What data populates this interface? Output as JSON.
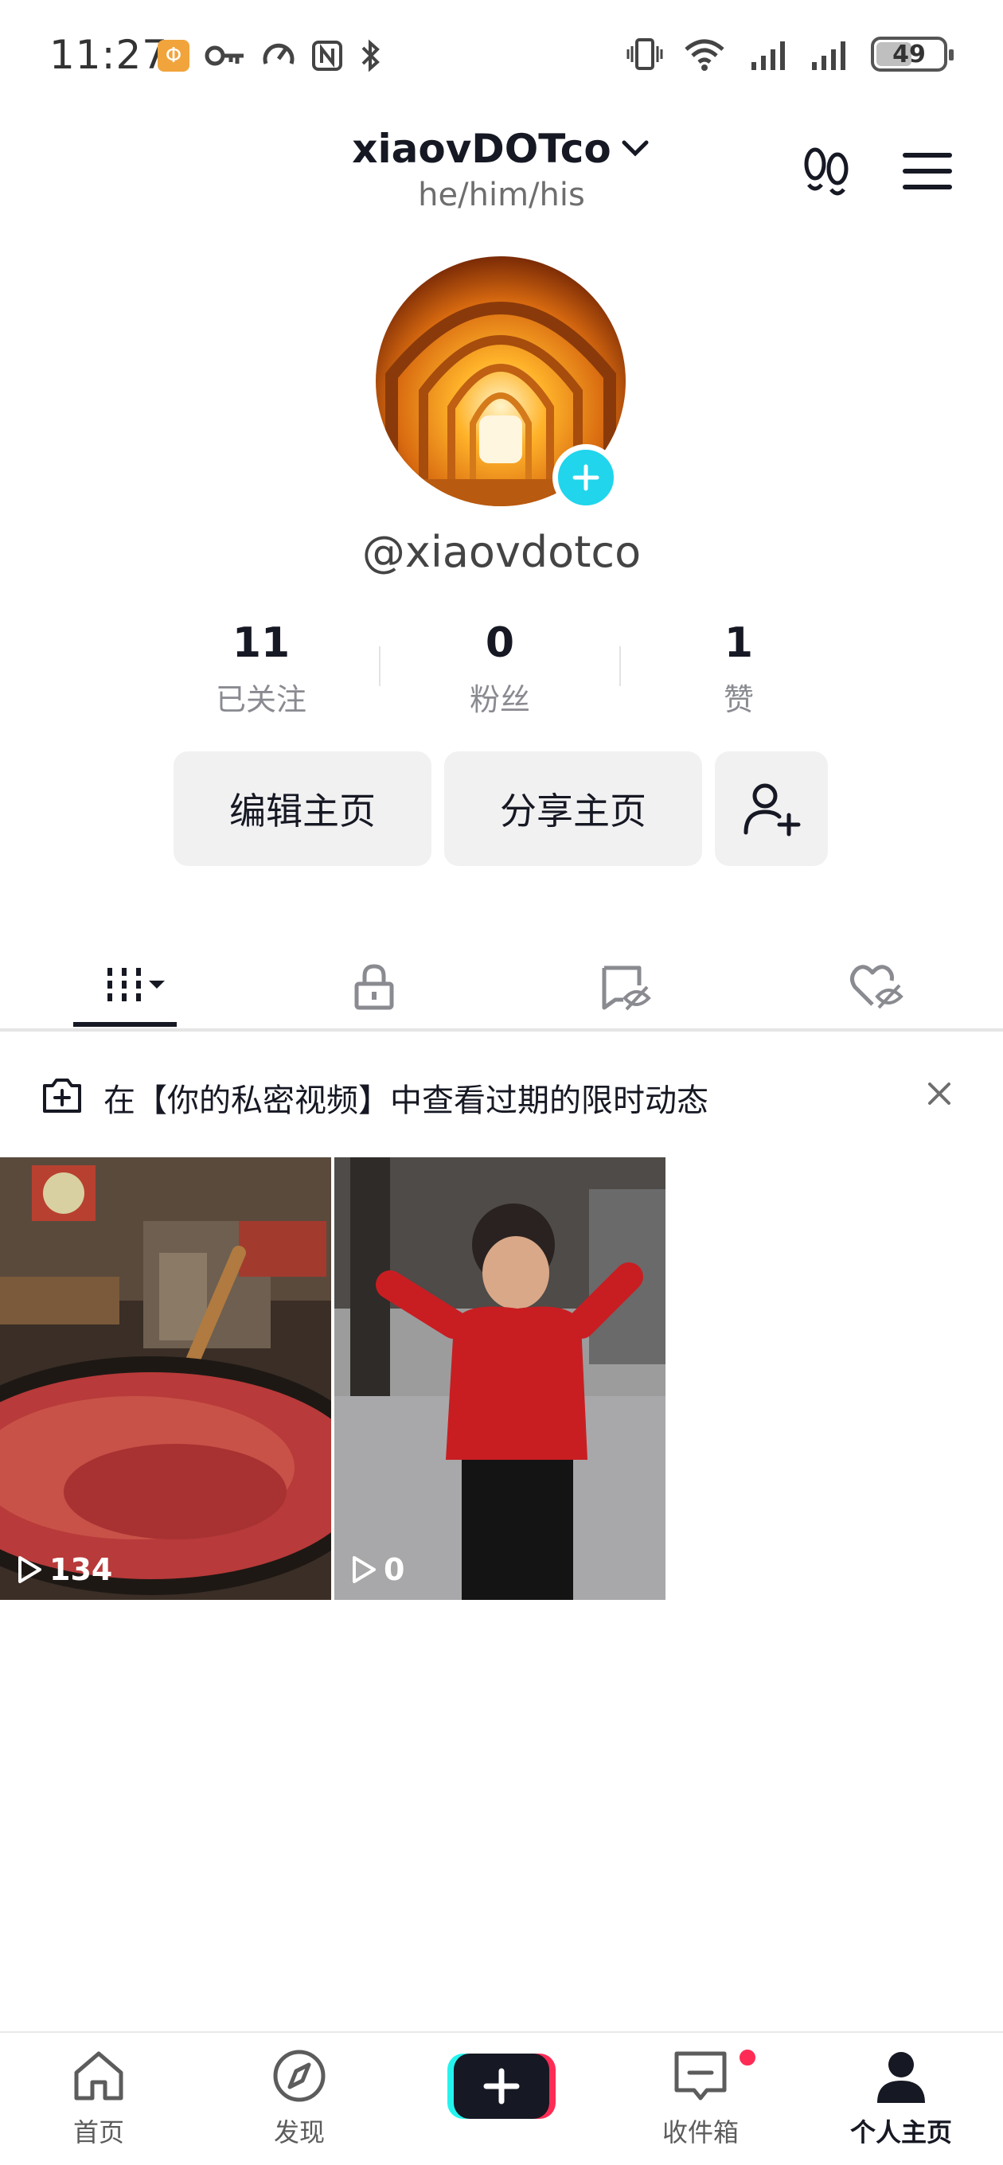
{
  "status_bar": {
    "time": "11:27",
    "battery": "49",
    "network": "6"
  },
  "header": {
    "username": "xiaovDOTco",
    "pronouns": "he/him/his"
  },
  "profile": {
    "handle": "@xiaovdotco"
  },
  "stats": [
    {
      "value": "11",
      "label": "已关注"
    },
    {
      "value": "0",
      "label": "粉丝"
    },
    {
      "value": "1",
      "label": "赞"
    }
  ],
  "actions": {
    "edit": "编辑主页",
    "share": "分享主页"
  },
  "banner": {
    "text": "在【你的私密视频】中查看过期的限时动态"
  },
  "videos": [
    {
      "views": "134"
    },
    {
      "views": "0"
    }
  ],
  "nav": {
    "home": "首页",
    "discover": "发现",
    "inbox": "收件箱",
    "profile": "个人主页"
  },
  "colors": {
    "accent_cyan": "#20d5ec",
    "accent_red": "#fe2c55"
  }
}
